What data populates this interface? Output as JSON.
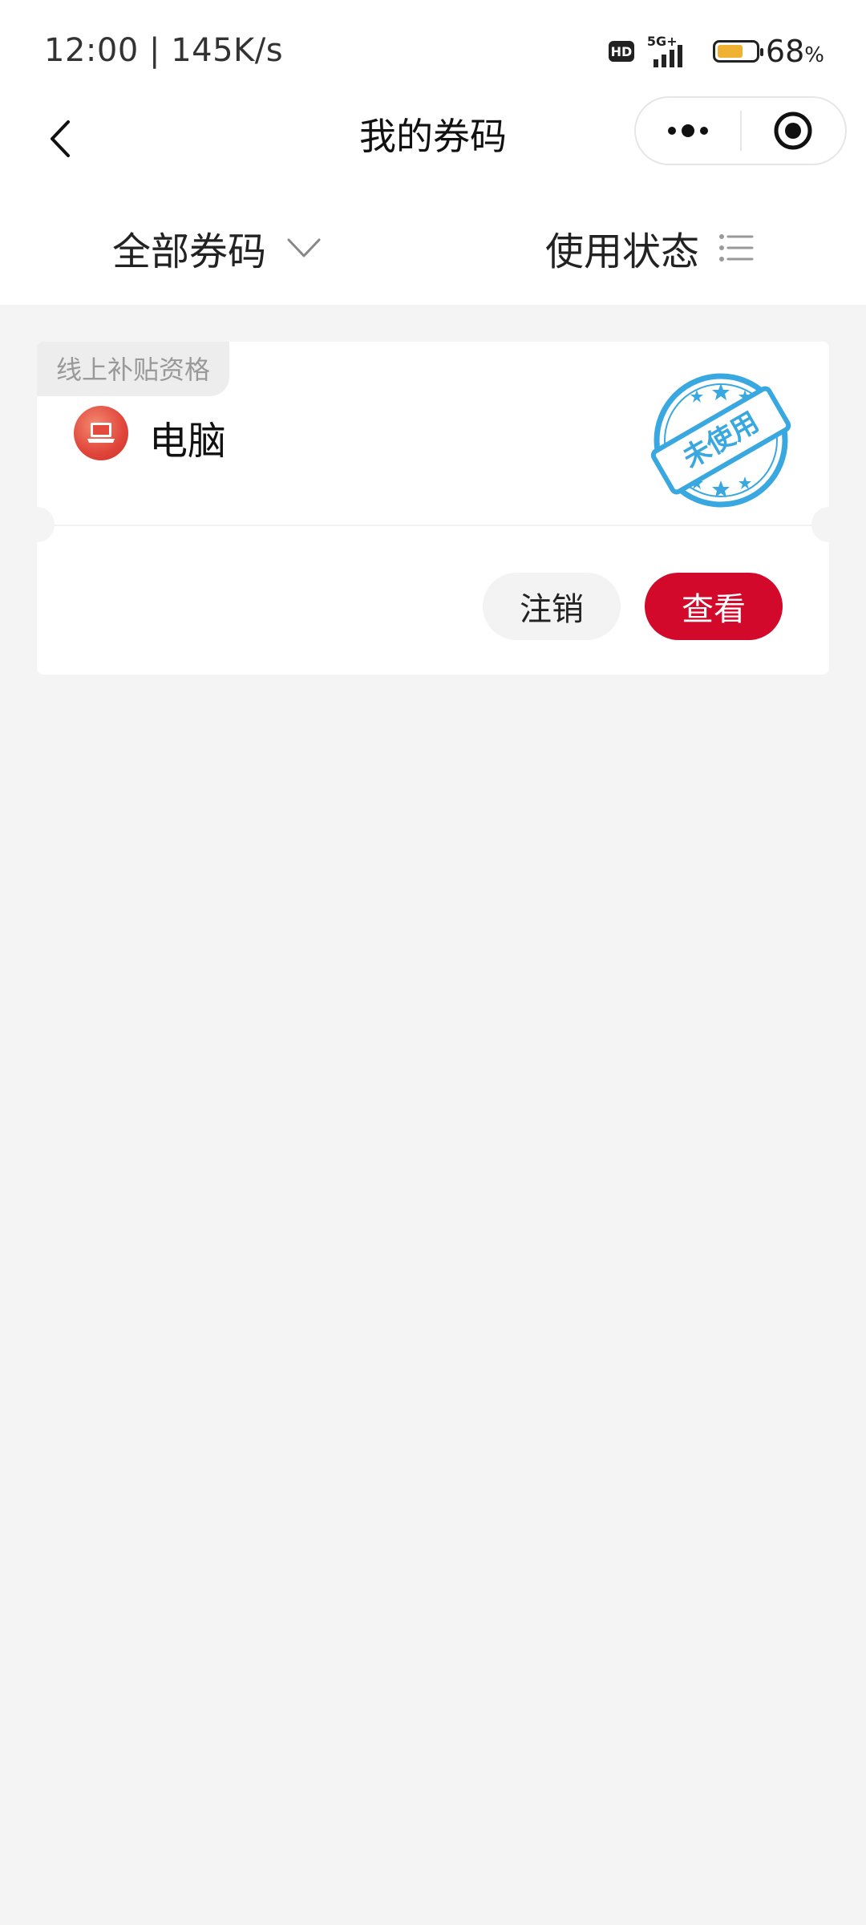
{
  "status_bar": {
    "time": "12:00",
    "network_speed": "145K/s",
    "hd_label": "HD",
    "signal_label": "5G+",
    "battery_percent": "68",
    "battery_unit": "%",
    "battery_level": 0.68
  },
  "nav": {
    "title": "我的券码",
    "back_icon": "chevron-left-icon",
    "more_icon": "more-dots-icon",
    "close_icon": "target-icon"
  },
  "filters": {
    "all_coupons_label": "全部券码",
    "status_label": "使用状态",
    "dropdown_icon": "chevron-down-icon",
    "list_icon": "list-icon"
  },
  "coupon": {
    "tag": "线上补贴资格",
    "product_name": "电脑",
    "product_icon": "laptop-icon",
    "stamp_text": "未使用",
    "cancel_label": "注销",
    "view_label": "查看"
  },
  "colors": {
    "accent": "#d2092a",
    "stamp_blue": "#3aa8e0",
    "background": "#f4f4f4",
    "battery": "#f0b233"
  }
}
